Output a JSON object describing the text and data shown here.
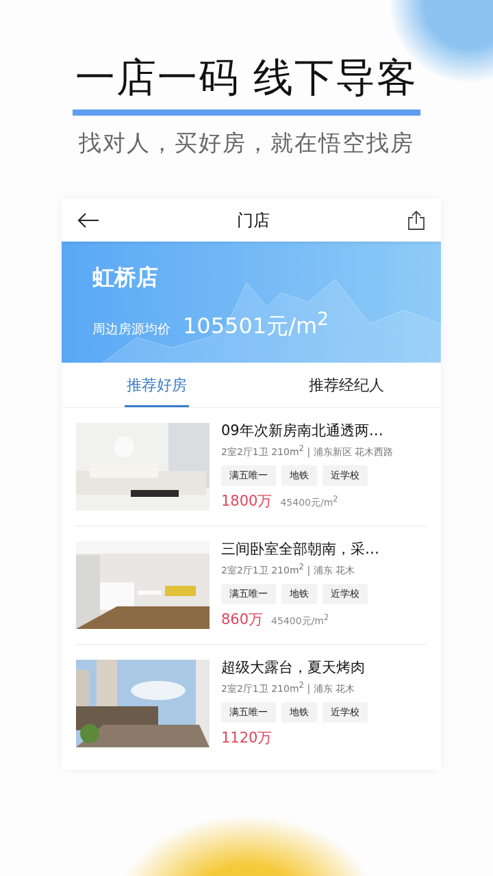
{
  "promo": {
    "headline": "一店一码 线下导客",
    "tagline": "找对人，买好房，就在悟空找房"
  },
  "nav": {
    "title": "门店"
  },
  "store": {
    "name": "虹桥店",
    "price_label": "周边房源均价",
    "price": "105501元/m$^{2}$"
  },
  "tabs": [
    {
      "label": "推荐好房",
      "selected": true
    },
    {
      "label": "推荐经纪人",
      "selected": false
    }
  ],
  "listings": [
    {
      "title": "09年次新房南北通透两…",
      "info": "2室2厅1卫 210m$^{2}$ | 浦东新区 花木西路",
      "tags": [
        "满五唯一",
        "地铁",
        "近学校"
      ],
      "price": "1800万",
      "unit_price": "45400元/m$^{2}$"
    },
    {
      "title": "三间卧室全部朝南，采…",
      "info": "2室2厅1卫 210m$^{2}$ | 浦东 花木",
      "tags": [
        "满五唯一",
        "地铁",
        "近学校"
      ],
      "price": "860万",
      "unit_price": "45400元/m$^{2}$"
    },
    {
      "title": "超级大露台，夏天烤肉",
      "info": "2室2厅1卫 210m$^{2}$ | 浦东 花木",
      "tags": [
        "满五唯一",
        "地铁",
        "近学校"
      ],
      "price": "1120万"
    }
  ]
}
